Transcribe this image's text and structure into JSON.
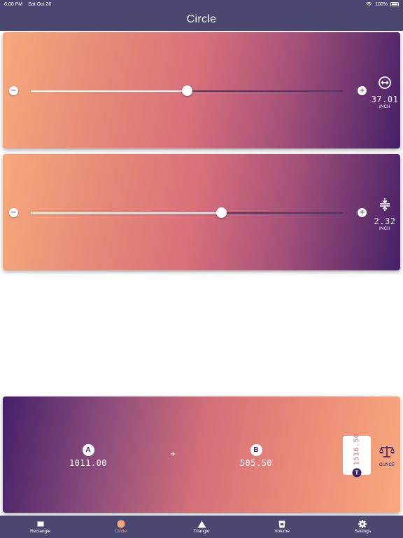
{
  "status_bar": {
    "time": "6:00 PM",
    "date": "Sat Oct 26",
    "battery": "100%"
  },
  "nav": {
    "title": "Circle"
  },
  "sliders": [
    {
      "minus_label": "−",
      "plus_label": "+",
      "fraction": 0.5,
      "value": "37.01",
      "unit": "INCH",
      "icon": "diameter-icon"
    },
    {
      "minus_label": "−",
      "plus_label": "+",
      "fraction": 0.61,
      "value": "2.32",
      "unit": "INCH",
      "icon": "thickness-icon"
    }
  ],
  "results": {
    "a_letter": "A",
    "a_value": "1011.00",
    "operator": "+",
    "b_letter": "B",
    "b_value": "505.50",
    "total_letter": "T",
    "total_value": "1516.50",
    "unit": "OUNCE",
    "unit_icon": "scale-icon"
  },
  "tabs": [
    {
      "label": "Rectangle",
      "icon": "rectangle-icon",
      "active": false
    },
    {
      "label": "Circle",
      "icon": "circle-icon",
      "active": true
    },
    {
      "label": "Triangle",
      "icon": "triangle-icon",
      "active": false
    },
    {
      "label": "Volume",
      "icon": "cup-icon",
      "active": false
    },
    {
      "label": "Settings",
      "icon": "gear-icon",
      "active": false
    }
  ],
  "colors": {
    "bar": "#4a4870",
    "accent": "#f7a97b",
    "dark": "#452068"
  }
}
